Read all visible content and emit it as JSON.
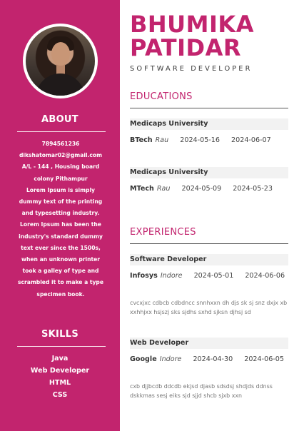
{
  "name": "BHUMIKA PATIDAR",
  "name_line1": "BHUMIKA",
  "name_line2": "PATIDAR",
  "role": "SOFTWARE DEVELOPER",
  "photo_alt": "profile photo",
  "sidebar": {
    "about_heading": "ABOUT",
    "phone": "7894561236",
    "email": "dikshatomar02@gmail.com",
    "address": "A/L - 144 , Housing board colony Pithampur",
    "summary": "Lorem Ipsum is simply dummy text of the printing and typesetting industry. Lorem Ipsum has been the industry's standard dummy text ever since the 1500s, when an unknown printer took a galley of type and scrambled it to make a type specimen book.",
    "skills_heading": "SKILLS",
    "skills": [
      "Java",
      "Web Developer",
      "HTML",
      "CSS"
    ]
  },
  "educations": {
    "title": "EDUCATIONS",
    "items": [
      {
        "institution": "Medicaps University",
        "degree": "BTech",
        "location": "Rau",
        "start": "2024-05-16",
        "end": "2024-06-07"
      },
      {
        "institution": "Medicaps University",
        "degree": "MTech",
        "location": "Rau",
        "start": "2024-05-09",
        "end": "2024-05-23"
      }
    ]
  },
  "experiences": {
    "title": "EXPERIENCES",
    "items": [
      {
        "position": "Software Developer",
        "company": "Infosys",
        "location": "Indore",
        "start": "2024-05-01",
        "end": "2024-06-06",
        "description": "cvcxjxc cdbcb cdbdncc snnhxxn dh djs sk sj snz dxjx xb xxhhjxx hsjszj sks sjdhs sxhd sjksn djhsj sd"
      },
      {
        "position": "Web Developer",
        "company": "Google",
        "location": "Indore",
        "start": "2024-04-30",
        "end": "2024-06-05",
        "description": "cxb djjbcdb ddcdb ekjsd djasb sdsdsj shdjds ddnss dskkmas sesj eiks sjd sjjd shcb sjxb xxn"
      }
    ]
  },
  "colors": {
    "accent": "#c2246e",
    "text": "#333333",
    "muted": "#777777"
  }
}
